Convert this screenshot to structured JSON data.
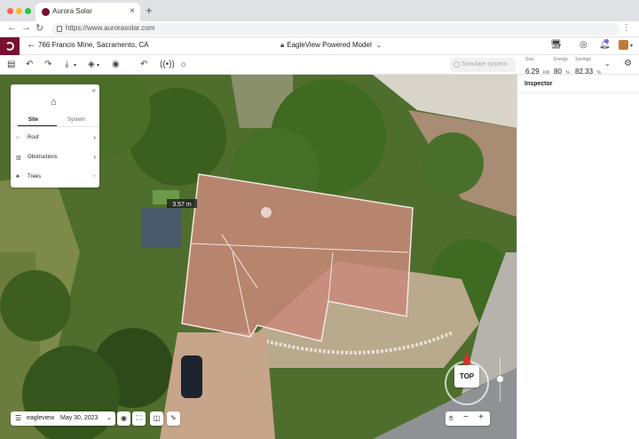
{
  "browser": {
    "tab_title": "Aurora Solar",
    "url": "https://www.aurorasolar.com"
  },
  "header": {
    "address": "766 Francis Mine, Sacramento, CA",
    "model": "EagleView Powered Model"
  },
  "toolbar": {
    "simulate_label": "Simulate system",
    "metrics": [
      {
        "label": "Size",
        "value": "6.29",
        "unit": "kW"
      },
      {
        "label": "Energy",
        "value": "80",
        "unit": "%"
      },
      {
        "label": "Savings",
        "value": "82.33",
        "unit": "%"
      }
    ]
  },
  "site_panel": {
    "tabs": [
      "Site",
      "System"
    ],
    "items": [
      {
        "label": "Roof",
        "icon": "roof-icon"
      },
      {
        "label": "Obstructions",
        "icon": "obstruction-icon"
      },
      {
        "label": "Trees",
        "icon": "tree-icon"
      }
    ]
  },
  "map": {
    "imagery_provider": "eagleview",
    "imagery_date": "May 30, 2023",
    "compass_label": "TOP",
    "measurement_label": "3.57 m"
  },
  "inspector": {
    "title": "Inspector"
  },
  "colors": {
    "brand": "#7a1030",
    "compass_north": "#e02b2b",
    "roof_overlay": "#c98a7a"
  }
}
